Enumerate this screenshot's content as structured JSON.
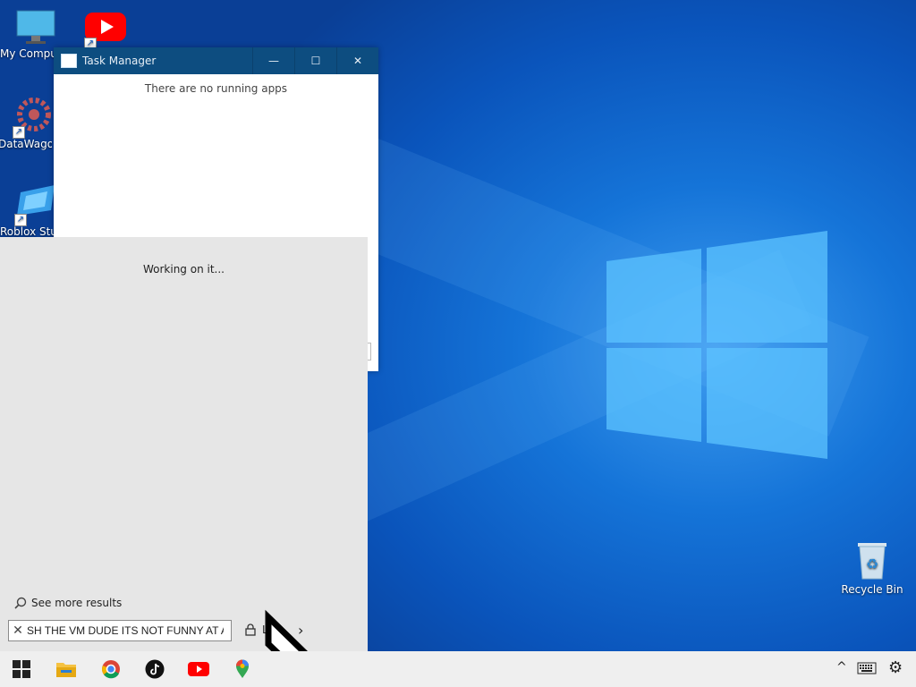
{
  "desktop": {
    "icons": [
      {
        "label": "My Computer"
      },
      {
        "label": "DataWagon"
      },
      {
        "label": "Roblox Studio"
      },
      {
        "label": "YouTube"
      }
    ],
    "recycle_bin": {
      "label": "Recycle Bin"
    }
  },
  "task_manager": {
    "title": "Task Manager",
    "minimize": "—",
    "maximize": "☐",
    "close": "✕",
    "empty_message": "There are no running apps"
  },
  "search_panel": {
    "status": "Working on it...",
    "see_more": "See more results",
    "query": "SH THE VM DUDE ITS NOT FUNNY AT ALL",
    "lock_label": "L",
    "clear_icon": "✕"
  },
  "taskbar": {
    "pinned": [
      "start",
      "file-explorer",
      "chrome",
      "tiktok",
      "youtube",
      "google-maps"
    ],
    "tray_chevron": "^"
  },
  "colors": {
    "titlebar": "#0d4d80",
    "desktop_blue": "#1574d8",
    "search_bg": "#e6e6e6",
    "taskbar": "#efefef"
  }
}
